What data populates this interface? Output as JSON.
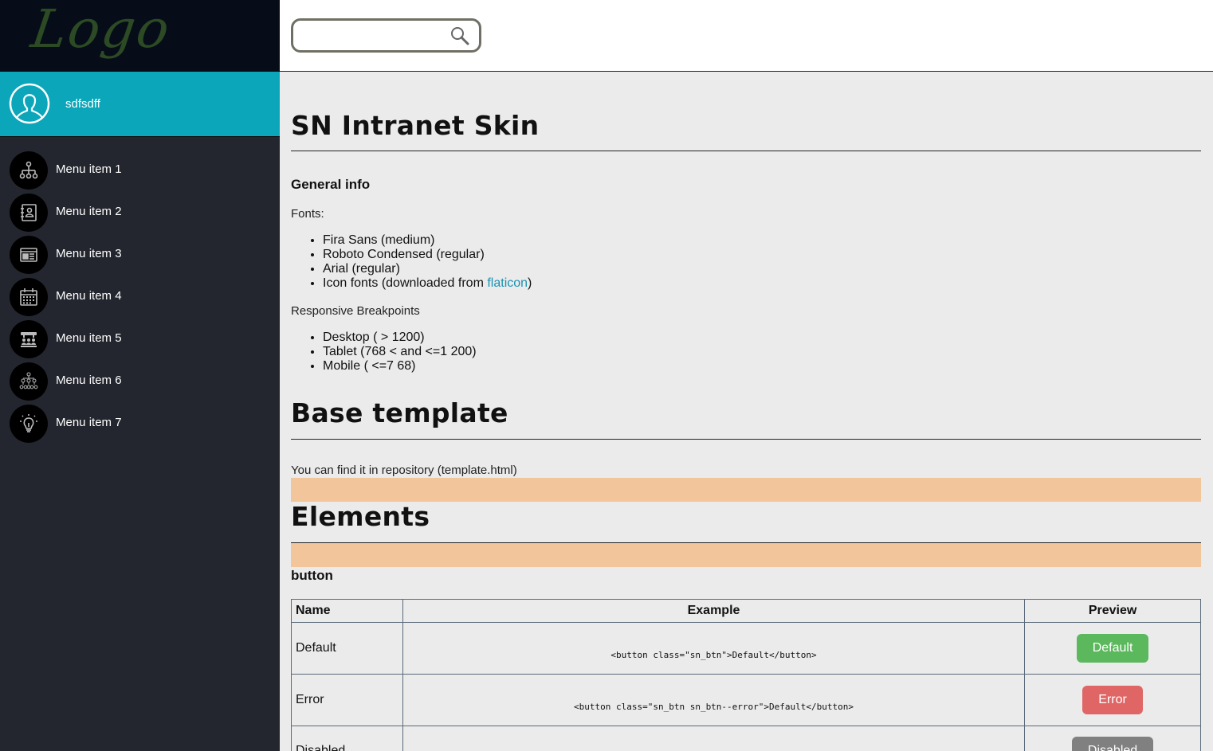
{
  "sidebar": {
    "logo": "Logo",
    "username": "sdfsdff",
    "menu": [
      {
        "label": "Menu item 1",
        "icon": "sitemap-icon"
      },
      {
        "label": "Menu item 2",
        "icon": "contact-book-icon"
      },
      {
        "label": "Menu item 3",
        "icon": "newspaper-icon"
      },
      {
        "label": "Menu item 4",
        "icon": "calendar-icon"
      },
      {
        "label": "Menu item 5",
        "icon": "meeting-icon"
      },
      {
        "label": "Menu item 6",
        "icon": "org-chart-icon"
      },
      {
        "label": "Menu item 7",
        "icon": "lightbulb-icon"
      }
    ]
  },
  "header": {
    "search_placeholder": "",
    "search_value": ""
  },
  "main": {
    "title": "SN Intranet Skin",
    "general_info": {
      "heading": "General info",
      "fonts_label": "Fonts:",
      "fonts": [
        "Fira Sans (medium)",
        "Roboto Condensed (regular)",
        "Arial (regular)"
      ],
      "icon_fonts_prefix": "Icon fonts (downloaded from ",
      "icon_fonts_link": "flaticon",
      "icon_fonts_suffix": ")",
      "breakpoints_label": "Responsive Breakpoints",
      "breakpoints": [
        "Desktop ( > 1200)",
        "Tablet (768 < and <=1 200)",
        "Mobile ( <=7 68)"
      ]
    },
    "base_template": {
      "title": "Base template",
      "text": "You can find it in repository (template.html)"
    },
    "elements": {
      "title": "Elements",
      "button_heading": "button",
      "table": {
        "headers": [
          "Name",
          "Example",
          "Preview"
        ],
        "rows": [
          {
            "name": "Default",
            "example": "<button class=\"sn_btn\">Default</button>",
            "preview": "Default",
            "color": "#5cb85c"
          },
          {
            "name": "Error",
            "example": "<button class=\"sn_btn sn_btn--error\">Default</button>",
            "preview": "Error",
            "color": "#e06666"
          },
          {
            "name": "Disabled",
            "example": "",
            "preview": "Disabled",
            "color": "#808080"
          }
        ]
      }
    }
  },
  "colors": {
    "sidebar_bg": "#23262e",
    "logo_bg": "#060d18",
    "user_bar": "#0ba6ba",
    "highlight_bar": "#f2c59a",
    "link": "#1a93b3"
  }
}
